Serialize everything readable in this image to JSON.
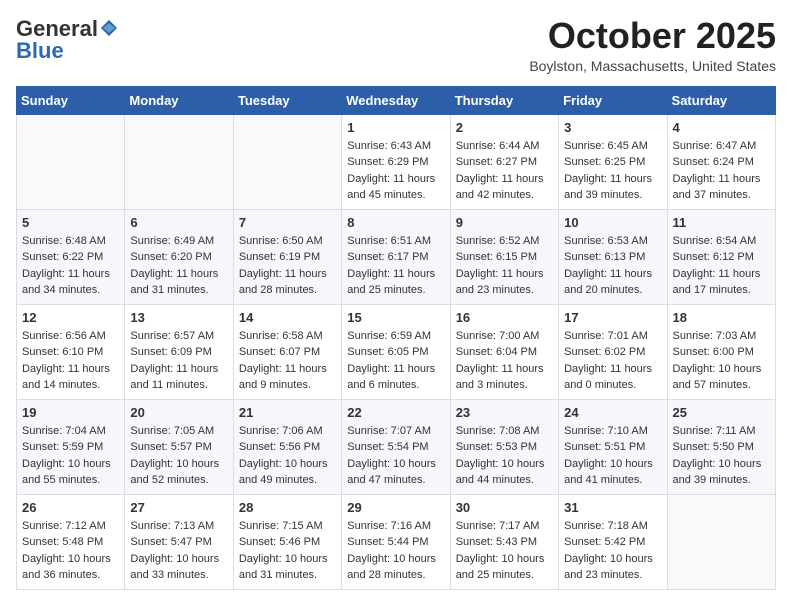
{
  "logo": {
    "general": "General",
    "blue": "Blue"
  },
  "header": {
    "month": "October 2025",
    "location": "Boylston, Massachusetts, United States"
  },
  "weekdays": [
    "Sunday",
    "Monday",
    "Tuesday",
    "Wednesday",
    "Thursday",
    "Friday",
    "Saturday"
  ],
  "weeks": [
    [
      {
        "day": "",
        "sunrise": "",
        "sunset": "",
        "daylight": ""
      },
      {
        "day": "",
        "sunrise": "",
        "sunset": "",
        "daylight": ""
      },
      {
        "day": "",
        "sunrise": "",
        "sunset": "",
        "daylight": ""
      },
      {
        "day": "1",
        "sunrise": "Sunrise: 6:43 AM",
        "sunset": "Sunset: 6:29 PM",
        "daylight": "Daylight: 11 hours and 45 minutes."
      },
      {
        "day": "2",
        "sunrise": "Sunrise: 6:44 AM",
        "sunset": "Sunset: 6:27 PM",
        "daylight": "Daylight: 11 hours and 42 minutes."
      },
      {
        "day": "3",
        "sunrise": "Sunrise: 6:45 AM",
        "sunset": "Sunset: 6:25 PM",
        "daylight": "Daylight: 11 hours and 39 minutes."
      },
      {
        "day": "4",
        "sunrise": "Sunrise: 6:47 AM",
        "sunset": "Sunset: 6:24 PM",
        "daylight": "Daylight: 11 hours and 37 minutes."
      }
    ],
    [
      {
        "day": "5",
        "sunrise": "Sunrise: 6:48 AM",
        "sunset": "Sunset: 6:22 PM",
        "daylight": "Daylight: 11 hours and 34 minutes."
      },
      {
        "day": "6",
        "sunrise": "Sunrise: 6:49 AM",
        "sunset": "Sunset: 6:20 PM",
        "daylight": "Daylight: 11 hours and 31 minutes."
      },
      {
        "day": "7",
        "sunrise": "Sunrise: 6:50 AM",
        "sunset": "Sunset: 6:19 PM",
        "daylight": "Daylight: 11 hours and 28 minutes."
      },
      {
        "day": "8",
        "sunrise": "Sunrise: 6:51 AM",
        "sunset": "Sunset: 6:17 PM",
        "daylight": "Daylight: 11 hours and 25 minutes."
      },
      {
        "day": "9",
        "sunrise": "Sunrise: 6:52 AM",
        "sunset": "Sunset: 6:15 PM",
        "daylight": "Daylight: 11 hours and 23 minutes."
      },
      {
        "day": "10",
        "sunrise": "Sunrise: 6:53 AM",
        "sunset": "Sunset: 6:13 PM",
        "daylight": "Daylight: 11 hours and 20 minutes."
      },
      {
        "day": "11",
        "sunrise": "Sunrise: 6:54 AM",
        "sunset": "Sunset: 6:12 PM",
        "daylight": "Daylight: 11 hours and 17 minutes."
      }
    ],
    [
      {
        "day": "12",
        "sunrise": "Sunrise: 6:56 AM",
        "sunset": "Sunset: 6:10 PM",
        "daylight": "Daylight: 11 hours and 14 minutes."
      },
      {
        "day": "13",
        "sunrise": "Sunrise: 6:57 AM",
        "sunset": "Sunset: 6:09 PM",
        "daylight": "Daylight: 11 hours and 11 minutes."
      },
      {
        "day": "14",
        "sunrise": "Sunrise: 6:58 AM",
        "sunset": "Sunset: 6:07 PM",
        "daylight": "Daylight: 11 hours and 9 minutes."
      },
      {
        "day": "15",
        "sunrise": "Sunrise: 6:59 AM",
        "sunset": "Sunset: 6:05 PM",
        "daylight": "Daylight: 11 hours and 6 minutes."
      },
      {
        "day": "16",
        "sunrise": "Sunrise: 7:00 AM",
        "sunset": "Sunset: 6:04 PM",
        "daylight": "Daylight: 11 hours and 3 minutes."
      },
      {
        "day": "17",
        "sunrise": "Sunrise: 7:01 AM",
        "sunset": "Sunset: 6:02 PM",
        "daylight": "Daylight: 11 hours and 0 minutes."
      },
      {
        "day": "18",
        "sunrise": "Sunrise: 7:03 AM",
        "sunset": "Sunset: 6:00 PM",
        "daylight": "Daylight: 10 hours and 57 minutes."
      }
    ],
    [
      {
        "day": "19",
        "sunrise": "Sunrise: 7:04 AM",
        "sunset": "Sunset: 5:59 PM",
        "daylight": "Daylight: 10 hours and 55 minutes."
      },
      {
        "day": "20",
        "sunrise": "Sunrise: 7:05 AM",
        "sunset": "Sunset: 5:57 PM",
        "daylight": "Daylight: 10 hours and 52 minutes."
      },
      {
        "day": "21",
        "sunrise": "Sunrise: 7:06 AM",
        "sunset": "Sunset: 5:56 PM",
        "daylight": "Daylight: 10 hours and 49 minutes."
      },
      {
        "day": "22",
        "sunrise": "Sunrise: 7:07 AM",
        "sunset": "Sunset: 5:54 PM",
        "daylight": "Daylight: 10 hours and 47 minutes."
      },
      {
        "day": "23",
        "sunrise": "Sunrise: 7:08 AM",
        "sunset": "Sunset: 5:53 PM",
        "daylight": "Daylight: 10 hours and 44 minutes."
      },
      {
        "day": "24",
        "sunrise": "Sunrise: 7:10 AM",
        "sunset": "Sunset: 5:51 PM",
        "daylight": "Daylight: 10 hours and 41 minutes."
      },
      {
        "day": "25",
        "sunrise": "Sunrise: 7:11 AM",
        "sunset": "Sunset: 5:50 PM",
        "daylight": "Daylight: 10 hours and 39 minutes."
      }
    ],
    [
      {
        "day": "26",
        "sunrise": "Sunrise: 7:12 AM",
        "sunset": "Sunset: 5:48 PM",
        "daylight": "Daylight: 10 hours and 36 minutes."
      },
      {
        "day": "27",
        "sunrise": "Sunrise: 7:13 AM",
        "sunset": "Sunset: 5:47 PM",
        "daylight": "Daylight: 10 hours and 33 minutes."
      },
      {
        "day": "28",
        "sunrise": "Sunrise: 7:15 AM",
        "sunset": "Sunset: 5:46 PM",
        "daylight": "Daylight: 10 hours and 31 minutes."
      },
      {
        "day": "29",
        "sunrise": "Sunrise: 7:16 AM",
        "sunset": "Sunset: 5:44 PM",
        "daylight": "Daylight: 10 hours and 28 minutes."
      },
      {
        "day": "30",
        "sunrise": "Sunrise: 7:17 AM",
        "sunset": "Sunset: 5:43 PM",
        "daylight": "Daylight: 10 hours and 25 minutes."
      },
      {
        "day": "31",
        "sunrise": "Sunrise: 7:18 AM",
        "sunset": "Sunset: 5:42 PM",
        "daylight": "Daylight: 10 hours and 23 minutes."
      },
      {
        "day": "",
        "sunrise": "",
        "sunset": "",
        "daylight": ""
      }
    ]
  ]
}
